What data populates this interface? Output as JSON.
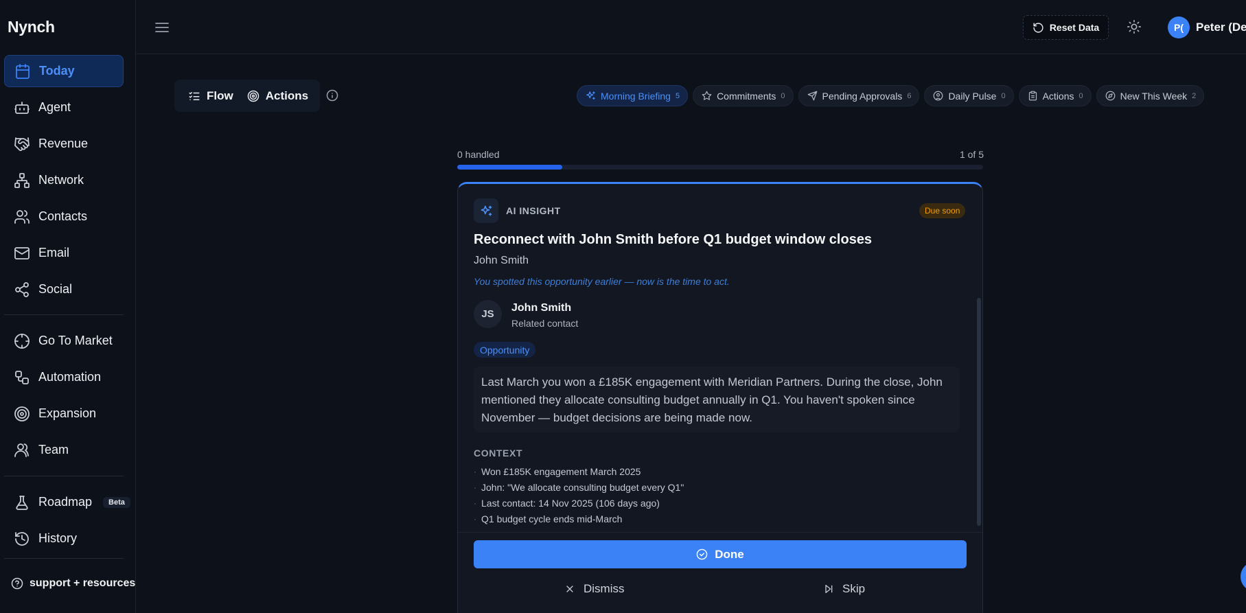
{
  "app": {
    "name": "Nynch"
  },
  "sidebar": {
    "items": [
      {
        "label": "Today",
        "icon": "calendar-icon"
      },
      {
        "label": "Agent",
        "icon": "bot-icon"
      },
      {
        "label": "Revenue",
        "icon": "handshake-icon"
      },
      {
        "label": "Network",
        "icon": "network-icon"
      },
      {
        "label": "Contacts",
        "icon": "users-icon"
      },
      {
        "label": "Email",
        "icon": "mail-icon"
      },
      {
        "label": "Social",
        "icon": "share-icon"
      },
      {
        "label": "Go To Market",
        "icon": "crosshair-icon"
      },
      {
        "label": "Automation",
        "icon": "workflow-icon"
      },
      {
        "label": "Expansion",
        "icon": "target-icon"
      },
      {
        "label": "Team",
        "icon": "team-icon"
      },
      {
        "label": "Roadmap",
        "icon": "flask-icon",
        "badge": "Beta"
      },
      {
        "label": "History",
        "icon": "history-icon"
      }
    ],
    "active": "Today",
    "support_label": "support + resources"
  },
  "header": {
    "reset_label": "Reset Data",
    "user_initials": "P(",
    "user_name": "Peter (De"
  },
  "mode_toggle": {
    "flow_label": "Flow",
    "actions_label": "Actions"
  },
  "filters": [
    {
      "label": "Morning Briefing",
      "count": "5",
      "icon": "sparkles-icon",
      "active": true
    },
    {
      "label": "Commitments",
      "count": "0",
      "icon": "star-icon"
    },
    {
      "label": "Pending Approvals",
      "count": "6",
      "icon": "send-icon"
    },
    {
      "label": "Daily Pulse",
      "count": "0",
      "icon": "user-circle-icon"
    },
    {
      "label": "Actions",
      "count": "0",
      "icon": "clipboard-icon"
    },
    {
      "label": "New This Week",
      "count": "2",
      "icon": "compass-icon"
    }
  ],
  "progress": {
    "handled_label": "0 handled",
    "position_label": "1 of 5",
    "fraction": 0.2
  },
  "card": {
    "type_label": "AI INSIGHT",
    "badge": "Due soon",
    "title": "Reconnect with John Smith before Q1 budget window closes",
    "subtitle": "John Smith",
    "hint": "You spotted this opportunity earlier — now is the time to act.",
    "contact": {
      "initials": "JS",
      "name": "John Smith",
      "role": "Related contact"
    },
    "tag": "Opportunity",
    "description": "Last March you won a £185K engagement with Meridian Partners. During the close, John mentioned they allocate consulting budget annually in Q1. You haven't spoken since November — budget decisions are being made now.",
    "context_title": "CONTEXT",
    "context": [
      "Won £185K engagement March 2025",
      "John: \"We allocate consulting budget every Q1\"",
      "Last contact: 14 Nov 2025 (106 days ago)",
      "Q1 budget cycle ends mid-March"
    ],
    "done_label": "Done",
    "dismiss_label": "Dismiss",
    "skip_label": "Skip"
  },
  "colors": {
    "accent": "#3b82f6",
    "background": "#0d111a",
    "warning": "#f59e0b"
  }
}
